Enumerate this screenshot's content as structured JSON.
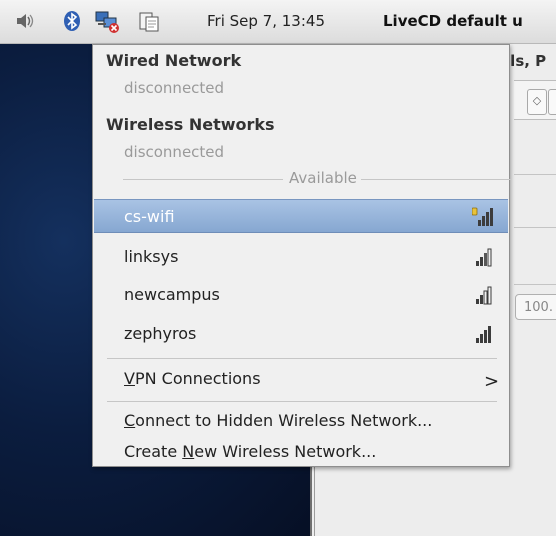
{
  "panel": {
    "tray_icons": [
      "volume-icon",
      "bluetooth-icon",
      "network-disconnected-icon",
      "clipboard-icon"
    ],
    "clock": "Fri Sep  7, 13:45",
    "user": "LiveCD default u"
  },
  "background_window": {
    "title_fragment": "els, P",
    "spin_glyph": "◇",
    "field_fragment": "100."
  },
  "menu": {
    "wired": {
      "title": "Wired Network",
      "status": "disconnected"
    },
    "wireless": {
      "title": "Wireless Networks",
      "status": "disconnected"
    },
    "available_label": "Available",
    "networks": [
      {
        "name": "cs-wifi",
        "selected": true,
        "secured": true
      },
      {
        "name": "linksys",
        "selected": false,
        "secured": false
      },
      {
        "name": "newcampus",
        "selected": false,
        "secured": false
      },
      {
        "name": "zephyros",
        "selected": false,
        "secured": false
      }
    ],
    "vpn": {
      "pre": "",
      "mnemonic": "V",
      "post": "PN Connections",
      "arrow": ">"
    },
    "hidden": {
      "pre": "",
      "mnemonic": "C",
      "post": "onnect to Hidden Wireless Network..."
    },
    "create": {
      "pre": "Create ",
      "mnemonic": "N",
      "post": "ew Wireless Network..."
    }
  },
  "colors": {
    "selection": "#86a7d1",
    "desktop": "#0b1d3f",
    "signal_bars": "#3c3c3c",
    "signal_lock": "#e8c23a"
  }
}
